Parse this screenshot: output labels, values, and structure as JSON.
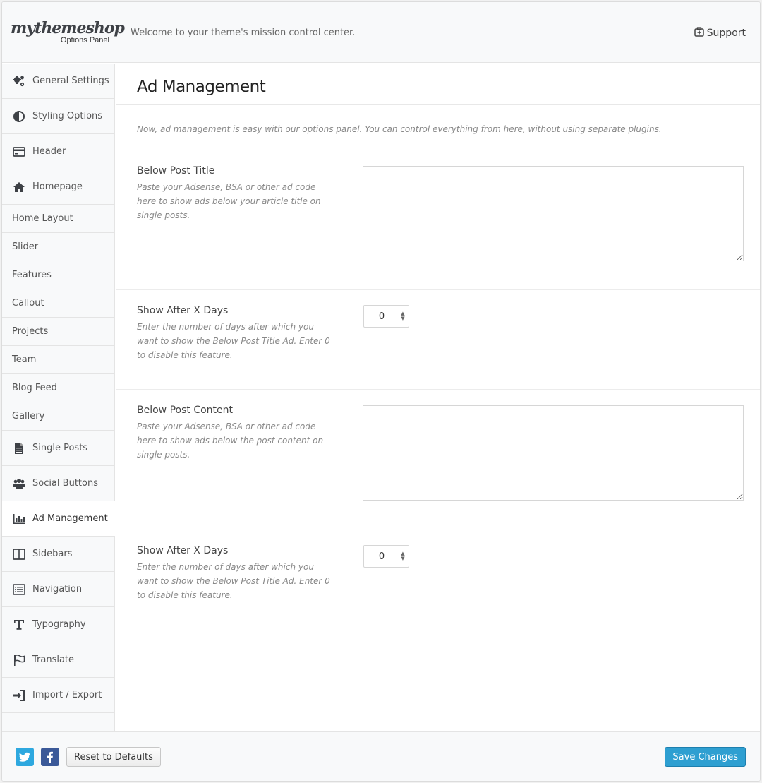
{
  "header": {
    "logo": "mythemeshop",
    "logo_sub": "Options Panel",
    "welcome": "Welcome to your theme's mission control center.",
    "support": "Support"
  },
  "sidebar": {
    "items": [
      {
        "label": "General Settings",
        "icon": "gears-icon"
      },
      {
        "label": "Styling Options",
        "icon": "contrast-icon"
      },
      {
        "label": "Header",
        "icon": "header-card-icon"
      },
      {
        "label": "Homepage",
        "icon": "home-icon"
      },
      {
        "label": "Home Layout"
      },
      {
        "label": "Slider"
      },
      {
        "label": "Features"
      },
      {
        "label": "Callout"
      },
      {
        "label": "Projects"
      },
      {
        "label": "Team"
      },
      {
        "label": "Blog Feed"
      },
      {
        "label": "Gallery"
      },
      {
        "label": "Single Posts",
        "icon": "document-icon"
      },
      {
        "label": "Social Buttons",
        "icon": "users-icon"
      },
      {
        "label": "Ad Management",
        "icon": "bar-chart-icon"
      },
      {
        "label": "Sidebars",
        "icon": "columns-icon"
      },
      {
        "label": "Navigation",
        "icon": "list-icon"
      },
      {
        "label": "Typography",
        "icon": "text-icon"
      },
      {
        "label": "Translate",
        "icon": "flag-icon"
      },
      {
        "label": "Import / Export",
        "icon": "sign-in-icon"
      }
    ]
  },
  "main": {
    "title": "Ad Management",
    "intro": "Now, ad management is easy with our options panel. You can control everything from here, without using separate plugins.",
    "options": [
      {
        "label": "Below Post Title",
        "desc": "Paste your Adsense, BSA or other ad code here to show ads below your article title on single posts.",
        "value": ""
      },
      {
        "label": "Show After X Days",
        "desc": "Enter the number of days after which you want to show the Below Post Title Ad. Enter 0 to disable this feature.",
        "value": "0"
      },
      {
        "label": "Below Post Content",
        "desc": "Paste your Adsense, BSA or other ad code here to show ads below the post content on single posts.",
        "value": ""
      },
      {
        "label": "Show After X Days",
        "desc": "Enter the number of days after which you want to show the Below Post Title Ad. Enter 0 to disable this feature.",
        "value": "0"
      }
    ]
  },
  "footer": {
    "reset": "Reset to Defaults",
    "save": "Save Changes"
  },
  "colors": {
    "accent": "#2e9fd1",
    "twitter": "#2ea8df",
    "facebook": "#3b5998"
  }
}
